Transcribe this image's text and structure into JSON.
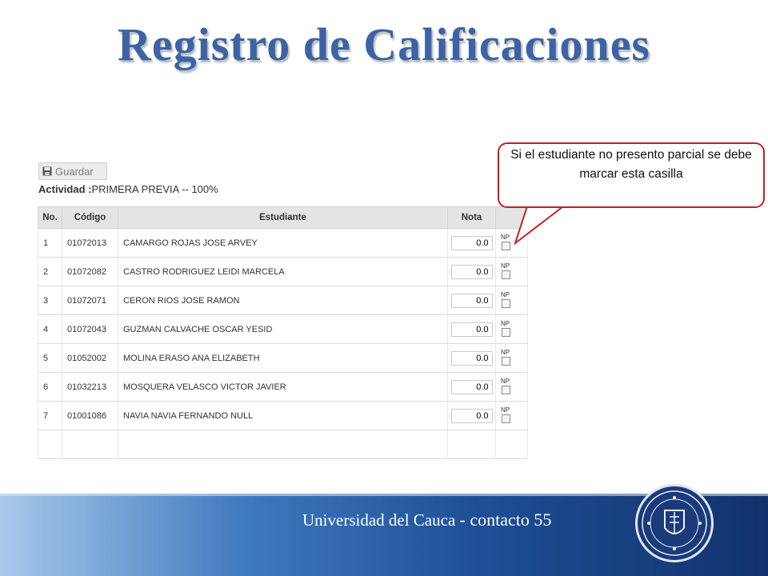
{
  "slide": {
    "title": "Registro de Calificaciones",
    "callout": "Si el estudiante no presento parcial se debe marcar esta casilla",
    "footer": {
      "institution": "Universidad del Cauca",
      "contact": "- contacto 55"
    }
  },
  "form": {
    "save_label": "Guardar",
    "save_icon": "floppy-disk-icon",
    "activity_label": "Actividad :",
    "activity_value": "PRIMERA PREVIA -- 100%",
    "columns": [
      "No.",
      "Código",
      "Estudiante",
      "Nota"
    ],
    "np_label": "NP",
    "rows": [
      {
        "no": "1",
        "code": "01072013",
        "name": "CAMARGO ROJAS JOSE ARVEY",
        "grade": "0.0"
      },
      {
        "no": "2",
        "code": "01072082",
        "name": "CASTRO RODRIGUEZ LEIDI MARCELA",
        "grade": "0.0"
      },
      {
        "no": "3",
        "code": "01072071",
        "name": "CERON RIOS JOSE RAMON",
        "grade": "0.0"
      },
      {
        "no": "4",
        "code": "01072043",
        "name": "GUZMAN CALVACHE OSCAR YESID",
        "grade": "0.0"
      },
      {
        "no": "5",
        "code": "01052002",
        "name": "MOLINA ERASO ANA ELIZABETH",
        "grade": "0.0"
      },
      {
        "no": "6",
        "code": "01032213",
        "name": "MOSQUERA VELASCO VICTOR JAVIER",
        "grade": "0.0"
      },
      {
        "no": "7",
        "code": "01001086",
        "name": "NAVIA NAVIA FERNANDO NULL",
        "grade": "0.0"
      }
    ]
  },
  "colors": {
    "title": "#3b63a6",
    "callout_border": "#c0202a",
    "footer_dark": "#12326d",
    "footer_light": "#a8c9ea"
  }
}
